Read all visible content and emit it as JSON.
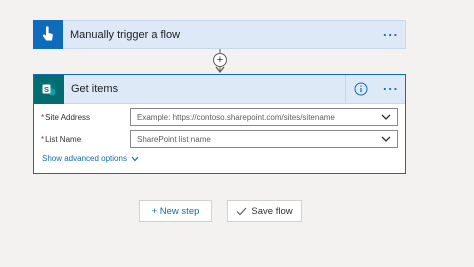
{
  "trigger": {
    "title": "Manually trigger a flow",
    "more_label": "···",
    "icon": "touch-hand-icon"
  },
  "connector": {
    "add_label": "+"
  },
  "action": {
    "title": "Get items",
    "icon": "sharepoint-icon",
    "more_label": "···",
    "fields": [
      {
        "label": "Site Address",
        "required_mark": "*",
        "placeholder": "Example: https://contoso.sharepoint.com/sites/sitename"
      },
      {
        "label": "List Name",
        "required_mark": "*",
        "placeholder": "SharePoint list name"
      }
    ],
    "advanced_label": "Show advanced options"
  },
  "buttons": {
    "new_step": "+ New step",
    "save_flow": "Save flow"
  },
  "colors": {
    "accent": "#0f6cbd",
    "sharepoint": "#036c70",
    "header_bg": "#dde9f7"
  }
}
